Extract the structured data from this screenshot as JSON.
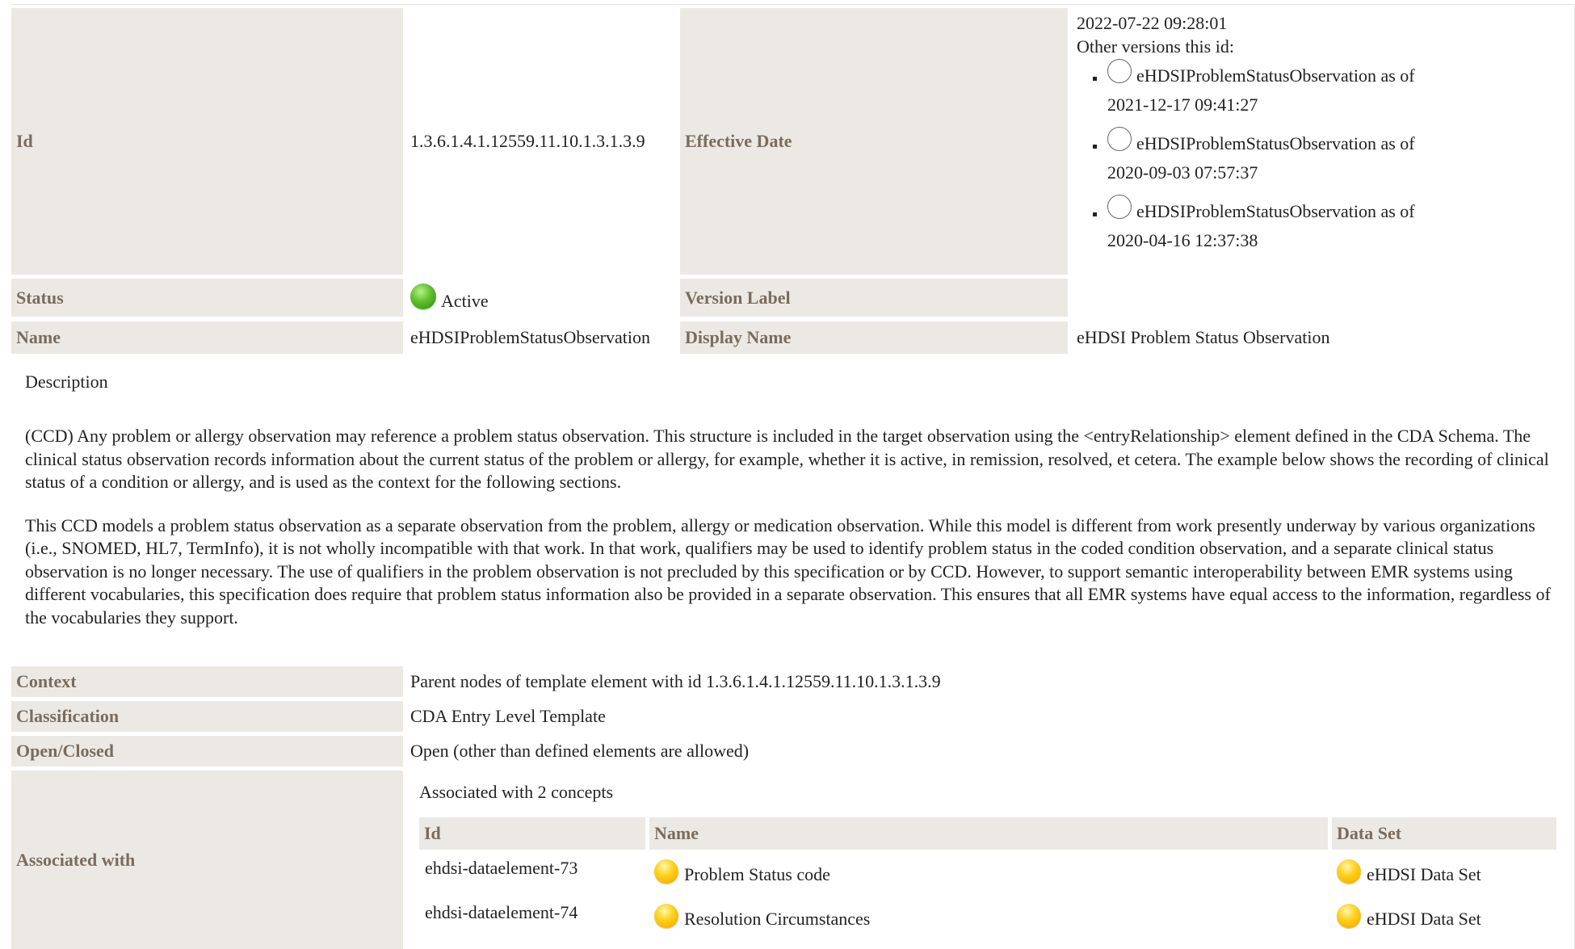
{
  "template": {
    "labels": {
      "id": "Id",
      "effective_date": "Effective Date",
      "status": "Status",
      "version_label": "Version Label",
      "name": "Name",
      "display_name": "Display Name"
    },
    "id": "1.3.6.1.4.1.12559.11.10.1.3.1.3.9",
    "effective_date": "2022-07-22 09:28:01",
    "other_versions_label": "Other versions this id:",
    "other_versions": [
      {
        "name": "eHDSIProblemStatusObservation as of",
        "date": "2021-12-17 09:41:27"
      },
      {
        "name": "eHDSIProblemStatusObservation as of",
        "date": "2020-09-03 07:57:37"
      },
      {
        "name": "eHDSIProblemStatusObservation as of",
        "date": "2020-04-16 12:37:38"
      }
    ],
    "status": "Active",
    "status_color": "#4caf26",
    "version_label": "",
    "name": "eHDSIProblemStatusObservation",
    "display_name": "eHDSI Problem Status Observation"
  },
  "description": {
    "heading": "Description",
    "paragraphs": [
      "(CCD) Any problem or allergy observation may reference a problem status observation. This structure is included in the target observation using the <entryRelationship> element defined in the CDA Schema. The clinical status observation records information about the current status of the problem or allergy, for example, whether it is active, in remission, resolved, et cetera. The example below shows the recording of clinical status of a condition or allergy, and is used as the context for the following sections.",
      "This CCD models a problem status observation as a separate observation from the problem, allergy or medication observation. While this model is different from work presently underway by various organizations (i.e., SNOMED, HL7, TermInfo), it is not wholly incompatible with that work. In that work, qualifiers may be used to identify problem status in the coded condition observation, and a separate clinical status observation is no longer necessary. The use of qualifiers in the problem observation is not precluded by this specification or by CCD. However, to support semantic interoperability between EMR systems using different vocabularies, this specification does require that problem status information also be provided in a separate observation. This ensures that all EMR systems have equal access to the information, regardless of the vocabularies they support."
    ]
  },
  "details": {
    "context_label": "Context",
    "context": "Parent nodes of template element with id 1.3.6.1.4.1.12559.11.10.1.3.1.3.9",
    "classification_label": "Classification",
    "classification": "CDA Entry Level Template",
    "open_closed_label": "Open/Closed",
    "open_closed": "Open (other than defined elements are allowed)",
    "associated_label": "Associated with",
    "associated_summary": "Associated with 2 concepts",
    "concept_columns": [
      "Id",
      "Name",
      "Data Set"
    ],
    "concepts": [
      {
        "id": "ehdsi-dataelement-73",
        "name": "Problem Status code",
        "dataset": "eHDSI Data Set"
      },
      {
        "id": "ehdsi-dataelement-74",
        "name": "Resolution Circumstances",
        "dataset": "eHDSI Data Set"
      }
    ],
    "concept_status_color": "#ffc20e"
  }
}
